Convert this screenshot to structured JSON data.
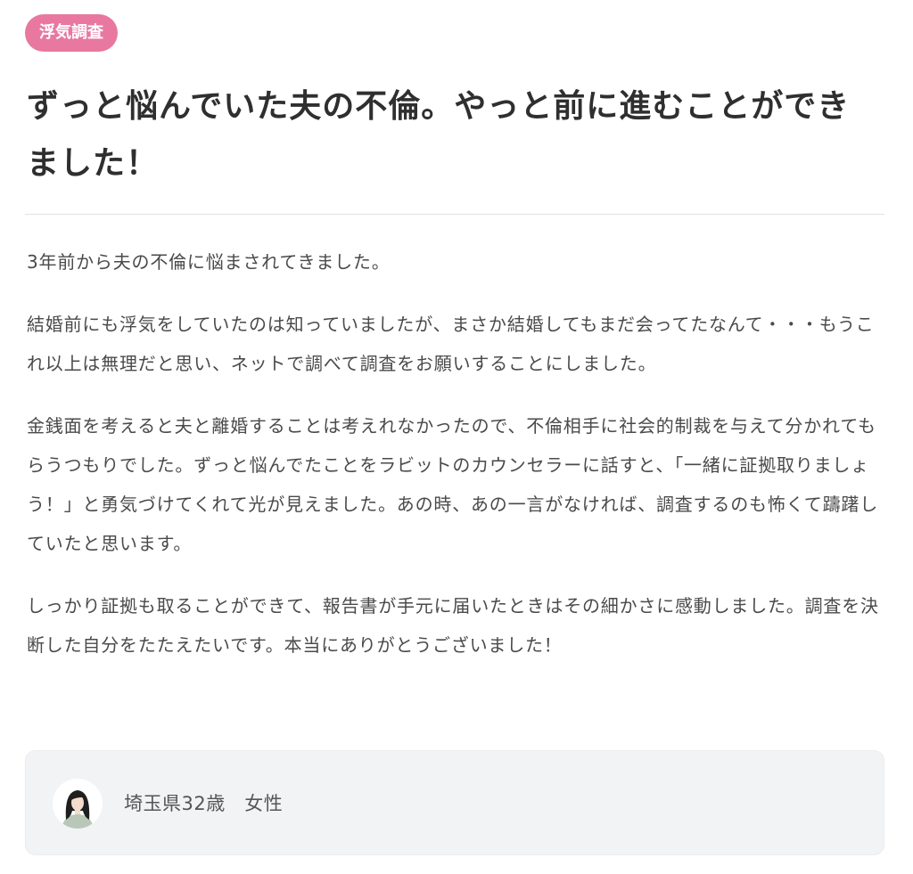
{
  "category_badge": "浮気調査",
  "title": "ずっと悩んでいた夫の不倫。やっと前に進むことができました！",
  "paragraphs": [
    "3年前から夫の不倫に悩まされてきました。",
    "結婚前にも浮気をしていたのは知っていましたが、まさか結婚してもまだ会ってたなんて・・・もうこれ以上は無理だと思い、ネットで調べて調査をお願いすることにしました。",
    "金銭面を考えると夫と離婚することは考えれなかったので、不倫相手に社会的制裁を与えて分かれてもらうつもりでした。ずっと悩んでたことをラビットのカウンセラーに話すと、「一緒に証拠取りましょう！」と勇気づけてくれて光が見えました。あの時、あの一言がなければ、調査するのも怖くて躊躇していたと思います。",
    "しっかり証拠も取ることができて、報告書が手元に届いたときはその細かさに感動しました。調査を決断した自分をたたえたいです。本当にありがとうございました！"
  ],
  "profile": {
    "label": "埼玉県32歳　女性",
    "avatar_icon": "woman-avatar-icon"
  },
  "colors": {
    "badge_bg": "#e8789f",
    "profile_bg": "#f2f3f5"
  }
}
